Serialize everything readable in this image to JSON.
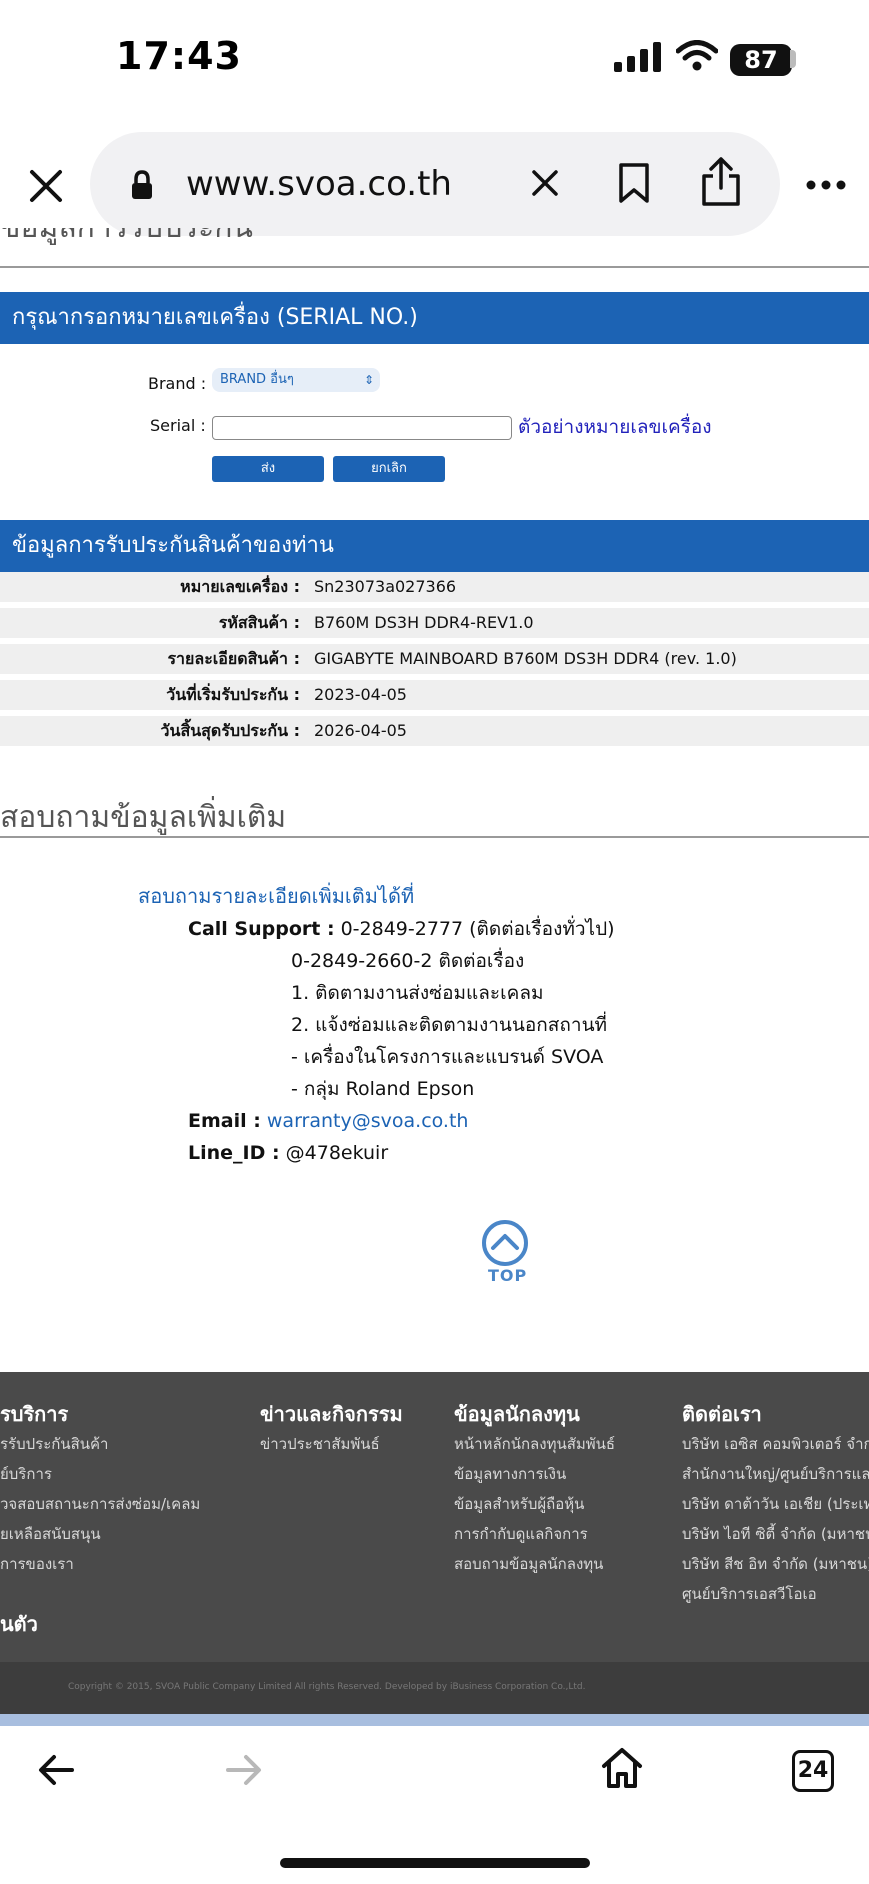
{
  "status_bar": {
    "time": "17:43",
    "battery": "87"
  },
  "browser": {
    "url": "www.svoa.co.th",
    "tab_count": "24"
  },
  "page": {
    "cut_heading": "ข้อมูลการรับประกัน",
    "serial_section": {
      "title": "กรุณากรอกหมายเลขเครื่อง (SERIAL NO.)",
      "brand_label": "Brand :",
      "brand_value": "BRAND อื่นๆ",
      "serial_label": "Serial :",
      "serial_value": "",
      "example_link": "ตัวอย่างหมายเลขเครื่อง",
      "submit": "ส่ง",
      "cancel": "ยกเลิก"
    },
    "warranty_section": {
      "title": "ข้อมูลการรับประกันสินค้าของท่าน",
      "rows": [
        {
          "label": "หมายเลขเครื่อง :",
          "value": "Sn23073a027366"
        },
        {
          "label": "รหัสสินค้า :",
          "value": "B760M DS3H DDR4-REV1.0"
        },
        {
          "label": "รายละเอียดสินค้า :",
          "value": "GIGABYTE MAINBOARD B760M DS3H DDR4 (rev. 1.0)"
        },
        {
          "label": "วันที่เริ่มรับประกัน :",
          "value": "2023-04-05"
        },
        {
          "label": "วันสิ้นสุดรับประกัน :",
          "value": "2026-04-05"
        }
      ]
    },
    "inquiry": {
      "heading": "สอบถามข้อมูลเพิ่มเติม",
      "title": "สอบถามรายละเอียดเพิ่มเติมได้ที่",
      "call_label": "Call Support :",
      "call_value": "0-2849-2777 (ติดต่อเรื่องทั่วไป)",
      "lines": [
        "0-2849-2660-2 ติดต่อเรื่อง",
        "1. ติดตามงานส่งซ่อมและเคลม",
        "2. แจ้งซ่อมและติดตามงานนอกสถานที่",
        "- เครื่องในโครงการและแบรนด์ SVOA",
        "- กลุ่ม Roland Epson"
      ],
      "email_label": "Email :",
      "email_value": "warranty@svoa.co.th",
      "line_label": "Line_ID :",
      "line_value": "@478ekuir"
    },
    "top_label": "TOP"
  },
  "footer": {
    "col1": {
      "title": "รบริการ",
      "links": [
        "รรับประกันสินค้า",
        "ย์บริการ",
        "วจสอบสถานะการส่งซ่อม/เคลม",
        "ยเหลือสนับสนุน",
        "การของเรา"
      ]
    },
    "col1b_title": "นตัว",
    "col2": {
      "title": "ข่าวและกิจกรรม",
      "links": [
        "ข่าวประชาสัมพันธ์"
      ]
    },
    "col3": {
      "title": "ข้อมูลนักลงทุน",
      "links": [
        "หน้าหลักนักลงทุนสัมพันธ์",
        "ข้อมูลทางการเงิน",
        "ข้อมูลสำหรับผู้ถือหุ้น",
        "การกำกับดูแลกิจการ",
        "สอบถามข้อมูลนักลงทุน"
      ]
    },
    "col4": {
      "title": "ติดต่อเรา",
      "links": [
        "บริษัท เอซิส คอมพิวเตอร์ จำก",
        "สำนักงานใหญ่/ศูนย์บริการและจั",
        "บริษัท ดาต้าวัน เอเชีย (ประเทศ",
        "บริษัท ไอที ซิตี้ จำกัด (มหาชน)",
        "บริษัท สีช อิท จำกัด (มหาชน)",
        "ศูนย์บริการเอสวีโอเอ"
      ]
    },
    "copyright": "Copyright © 2015, SVOA Public Company Limited All rights Reserved. Developed by iBusiness Corporation Co.,Ltd."
  }
}
